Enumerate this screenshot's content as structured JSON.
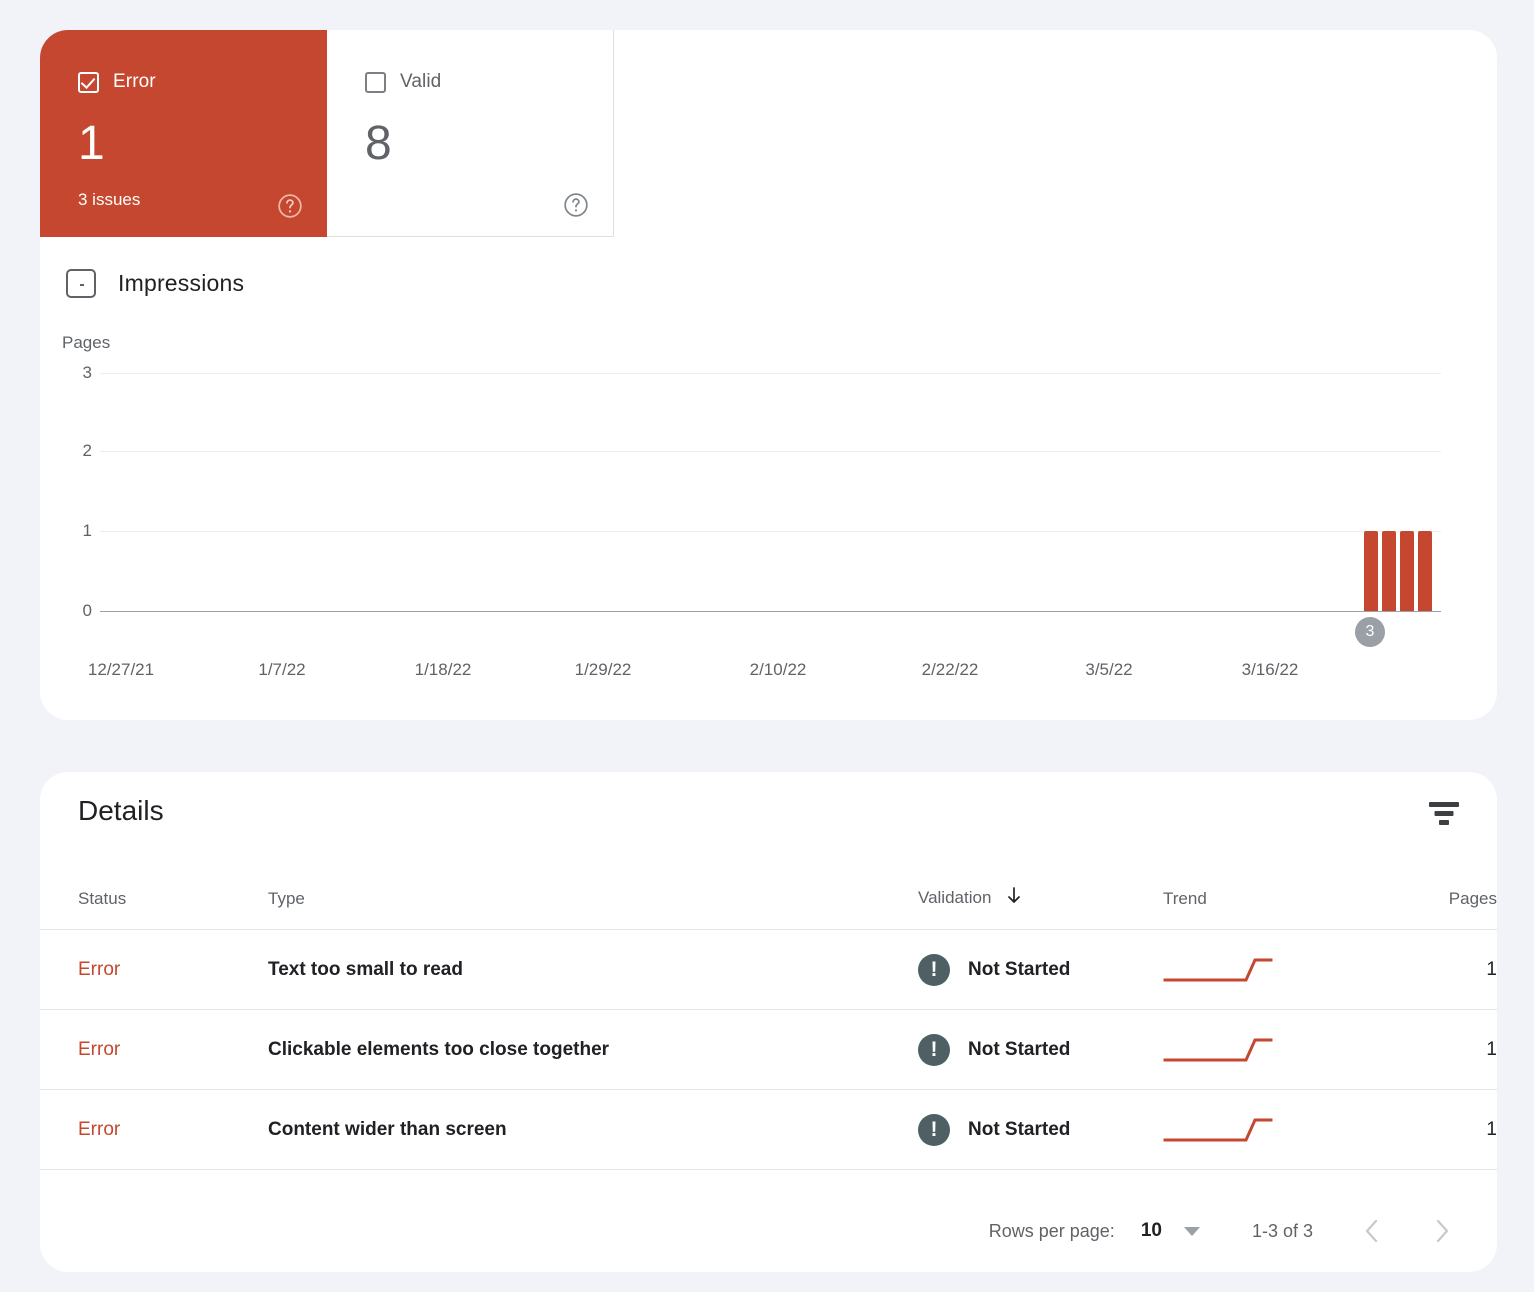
{
  "summary": {
    "cards": [
      {
        "name": "error",
        "label": "Error",
        "count": "1",
        "sub": "3 issues",
        "checked": true,
        "color": "#c5472f",
        "help_icon": "help-circle-icon"
      },
      {
        "name": "valid",
        "label": "Valid",
        "count": "8",
        "sub": "",
        "checked": false,
        "color": "#5f6368",
        "help_icon": "help-circle-icon"
      }
    ]
  },
  "impressions": {
    "label": "Impressions",
    "checked": false
  },
  "chart_data": {
    "type": "bar",
    "title": "",
    "ylabel": "Pages",
    "xlabel": "",
    "ylim": [
      0,
      3
    ],
    "yticks": [
      "0",
      "1",
      "2",
      "3"
    ],
    "grid": true,
    "legend": "none",
    "series_color": "#c5472f",
    "categories": [
      "12/27/21",
      "1/7/22",
      "1/18/22",
      "1/29/22",
      "2/10/22",
      "2/22/22",
      "3/5/22",
      "3/16/22"
    ],
    "x_tick_labels": [
      "12/27/21",
      "1/7/22",
      "1/18/22",
      "1/29/22",
      "2/10/22",
      "2/22/22",
      "3/5/22",
      "3/16/22"
    ],
    "bars": [
      {
        "x": "3/23/22",
        "value": 1
      },
      {
        "x": "3/24/22",
        "value": 1
      },
      {
        "x": "3/25/22",
        "value": 1
      },
      {
        "x": "3/26/22",
        "value": 1
      }
    ],
    "values": [
      1,
      1,
      1,
      1
    ],
    "annotation_badge": "3"
  },
  "details": {
    "title": "Details",
    "filter_icon": "filter-icon",
    "columns": [
      {
        "key": "status",
        "label": "Status",
        "sorted": false
      },
      {
        "key": "type",
        "label": "Type",
        "sorted": false
      },
      {
        "key": "validation",
        "label": "Validation",
        "sorted": true,
        "sort_direction": "down"
      },
      {
        "key": "trend",
        "label": "Trend",
        "sorted": false
      },
      {
        "key": "pages",
        "label": "Pages",
        "sorted": false
      }
    ],
    "rows": [
      {
        "status": "Error",
        "type": "Text too small to read",
        "validation": "Not Started",
        "validation_icon": "exclamation-circle-icon",
        "trend": "step-up-sparkline",
        "pages": "1"
      },
      {
        "status": "Error",
        "type": "Clickable elements too close together",
        "validation": "Not Started",
        "validation_icon": "exclamation-circle-icon",
        "trend": "step-up-sparkline",
        "pages": "1"
      },
      {
        "status": "Error",
        "type": "Content wider than screen",
        "validation": "Not Started",
        "validation_icon": "exclamation-circle-icon",
        "trend": "step-up-sparkline",
        "pages": "1"
      }
    ],
    "footer": {
      "rows_per_page_label": "Rows per page:",
      "rows_per_page_value": "10",
      "range_label": "1-3 of 3",
      "prev_icon": "chevron-left-icon",
      "next_icon": "chevron-right-icon"
    }
  }
}
